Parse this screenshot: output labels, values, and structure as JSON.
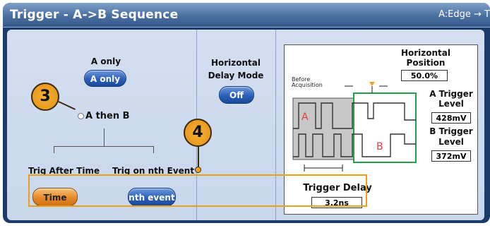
{
  "window": {
    "title": "Trigger - A->B Sequence",
    "trigger_summary": "A:Edge → T"
  },
  "sequence": {
    "a_only_label": "A only",
    "a_only_button": "A only",
    "a_then_b_label": "A then B",
    "trig_after_time_label": "Trig After Time",
    "trig_on_nth_label": "Trig on nth Event",
    "time_button": "Time",
    "nth_event_button": "nth event"
  },
  "horizontal_delay": {
    "label_line1": "Horizontal",
    "label_line2": "Delay Mode",
    "button": "Off"
  },
  "diagram": {
    "horizontal_position_line1": "Horizontal",
    "horizontal_position_line2": "Position",
    "horizontal_position_value": "50.0%",
    "before_acq_line1": "Before",
    "before_acq_line2": "Acquisition",
    "marker_a": "A",
    "marker_b": "B",
    "a_trigger_line1": "A Trigger",
    "a_trigger_line2": "Level",
    "a_trigger_value": "428mV",
    "b_trigger_line1": "B Trigger",
    "b_trigger_line2": "Level",
    "b_trigger_value": "372mV",
    "trigger_delay_label": "Trigger Delay",
    "trigger_delay_value": "3.2ns"
  },
  "callouts": {
    "first": "3",
    "second": "4"
  },
  "colors": {
    "panel": "#1c3b6a",
    "body": "#cfdaee",
    "button_blue": "#2b5fb8",
    "button_orange": "#e58a2a",
    "callout": "#f0a22a",
    "highlight": "#e7a21a",
    "green_box": "#1fa04a",
    "marker_red": "#e04040"
  }
}
